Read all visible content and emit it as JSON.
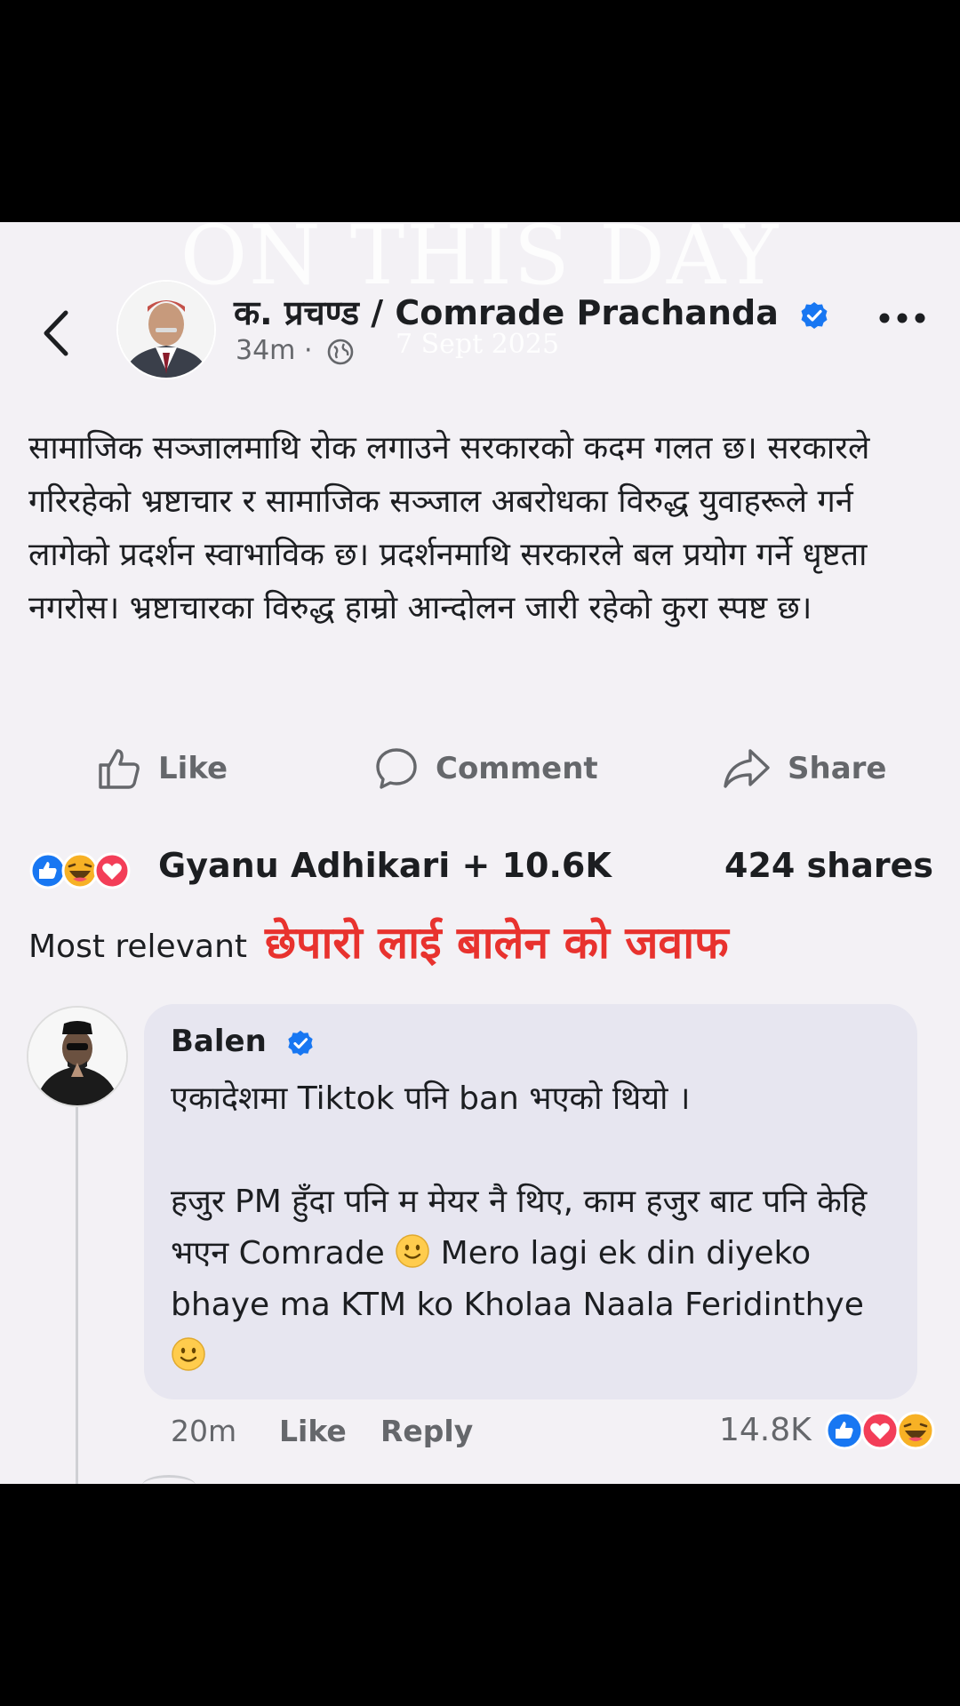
{
  "watermark": {
    "title": "ON THIS DAY",
    "date": "7 Sept 2025"
  },
  "post": {
    "author": "क. प्रचण्ड / Comrade Prachanda",
    "time": "34m",
    "separator": "·",
    "text": "सामाजिक सञ्जालमाथि रोक लगाउने सरकारको कदम गलत छ। सरकारले गरिरहेको भ्रष्टाचार र सामाजिक सञ्जाल अबरोधका विरुद्ध युवाहरूले गर्न लागेको प्रदर्शन स्वाभाविक छ। प्रदर्शनमाथि सरकारले बल प्रयोग गर्ने धृष्टता नगरोस। भ्रष्टाचारका विरुद्ध हाम्रो आन्दोलन जारी रहेको कुरा स्पष्ट छ।",
    "actions": {
      "like": "Like",
      "comment": "Comment",
      "share": "Share"
    },
    "reactions_text": "Gyanu Adhikari + 10.6K",
    "shares": "424 shares"
  },
  "sort_label": "Most relevant",
  "caption": "छेपारो लाई बालेन को जवाफ",
  "comment": {
    "author": "Balen",
    "line1": "एकादेशमा Tiktok पनि ban भएको थियो ।",
    "line2a": "हजुर PM हुँदा पनि म मेयर नै थिए, काम हजुर बाट पनि केहि भएन Comrade",
    "line2b": "Mero lagi ek din diyeko bhaye ma KTM ko Kholaa Naala Feridinthye",
    "time": "20m",
    "like": "Like",
    "reply": "Reply",
    "reaction_count": "14.8K"
  },
  "colors": {
    "verified": "#1877f2",
    "caption": "#e8322e",
    "like_blue": "#1877f2",
    "love_red": "#f33e58",
    "haha_yellow": "#f7b125"
  },
  "icons": [
    "back-arrow-icon",
    "verified-badge-icon",
    "globe-icon",
    "more-options-icon",
    "like-icon",
    "comment-icon",
    "share-icon",
    "like-reaction-icon",
    "haha-reaction-icon",
    "love-reaction-icon",
    "smile-emoji-icon"
  ]
}
